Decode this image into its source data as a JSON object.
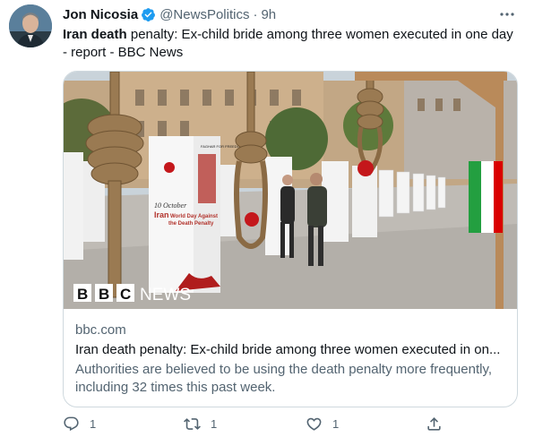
{
  "tweet": {
    "author_name": "Jon Nicosia",
    "handle": "@NewsPolitics",
    "separator": "·",
    "time": "9h",
    "text_bold": "Iran death",
    "text_rest": " penalty: Ex-child bride among three women executed in one day - report - BBC News"
  },
  "card": {
    "domain": "bbc.com",
    "title": "Iran death penalty: Ex-child bride among three women executed in on...",
    "description": "Authorities are believed to be using the death penalty more frequently, including 32 times this past week.",
    "bbc_letters": [
      "B",
      "B",
      "C"
    ],
    "news_word": "NEWS",
    "sign_banner": "FAGHAR FOR FREEDOM IN IRAN",
    "sign_date": "10 October",
    "sign_line1": "Iran",
    "sign_line2": "World Day Against",
    "sign_line3": "the Death Penalty"
  },
  "actions": {
    "reply_count": "1",
    "retweet_count": "1",
    "like_count": "1"
  },
  "colors": {
    "verified": "#1d9bf0",
    "secondary_text": "#536471",
    "border": "#cfd9de"
  },
  "icons": {
    "verified": "verified-badge-icon",
    "more": "more-options-icon",
    "reply": "reply-icon",
    "retweet": "retweet-icon",
    "like": "heart-icon",
    "share": "share-icon"
  }
}
